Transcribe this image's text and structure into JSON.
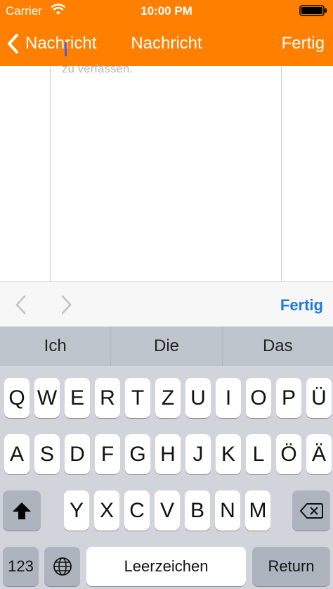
{
  "status_bar": {
    "carrier": "Carrier",
    "time": "10:00 PM"
  },
  "nav": {
    "back_label": "Nachricht",
    "title": "Nachricht",
    "done_label": "Fertig"
  },
  "editor": {
    "placeholder": "zu verfassen."
  },
  "accessory": {
    "done_label": "Fertig"
  },
  "keyboard": {
    "suggestions": [
      "Ich",
      "Die",
      "Das"
    ],
    "row1": [
      "Q",
      "W",
      "E",
      "R",
      "T",
      "Z",
      "U",
      "I",
      "O",
      "P",
      "Ü"
    ],
    "row2": [
      "A",
      "S",
      "D",
      "F",
      "G",
      "H",
      "J",
      "K",
      "L",
      "Ö",
      "Ä"
    ],
    "row3": [
      "Y",
      "X",
      "C",
      "V",
      "B",
      "N",
      "M"
    ],
    "mode_key": "123",
    "space_key": "Leerzeichen",
    "return_key": "Return"
  },
  "icons": {
    "wifi": "wifi-icon",
    "battery": "battery-icon",
    "back": "chevron-left-icon",
    "shift": "shift-icon",
    "delete": "backspace-icon",
    "globe": "globe-icon"
  },
  "colors": {
    "nav": "#ff7f00",
    "accent": "#1f7ae0",
    "keyboard": "#d1d5db"
  }
}
